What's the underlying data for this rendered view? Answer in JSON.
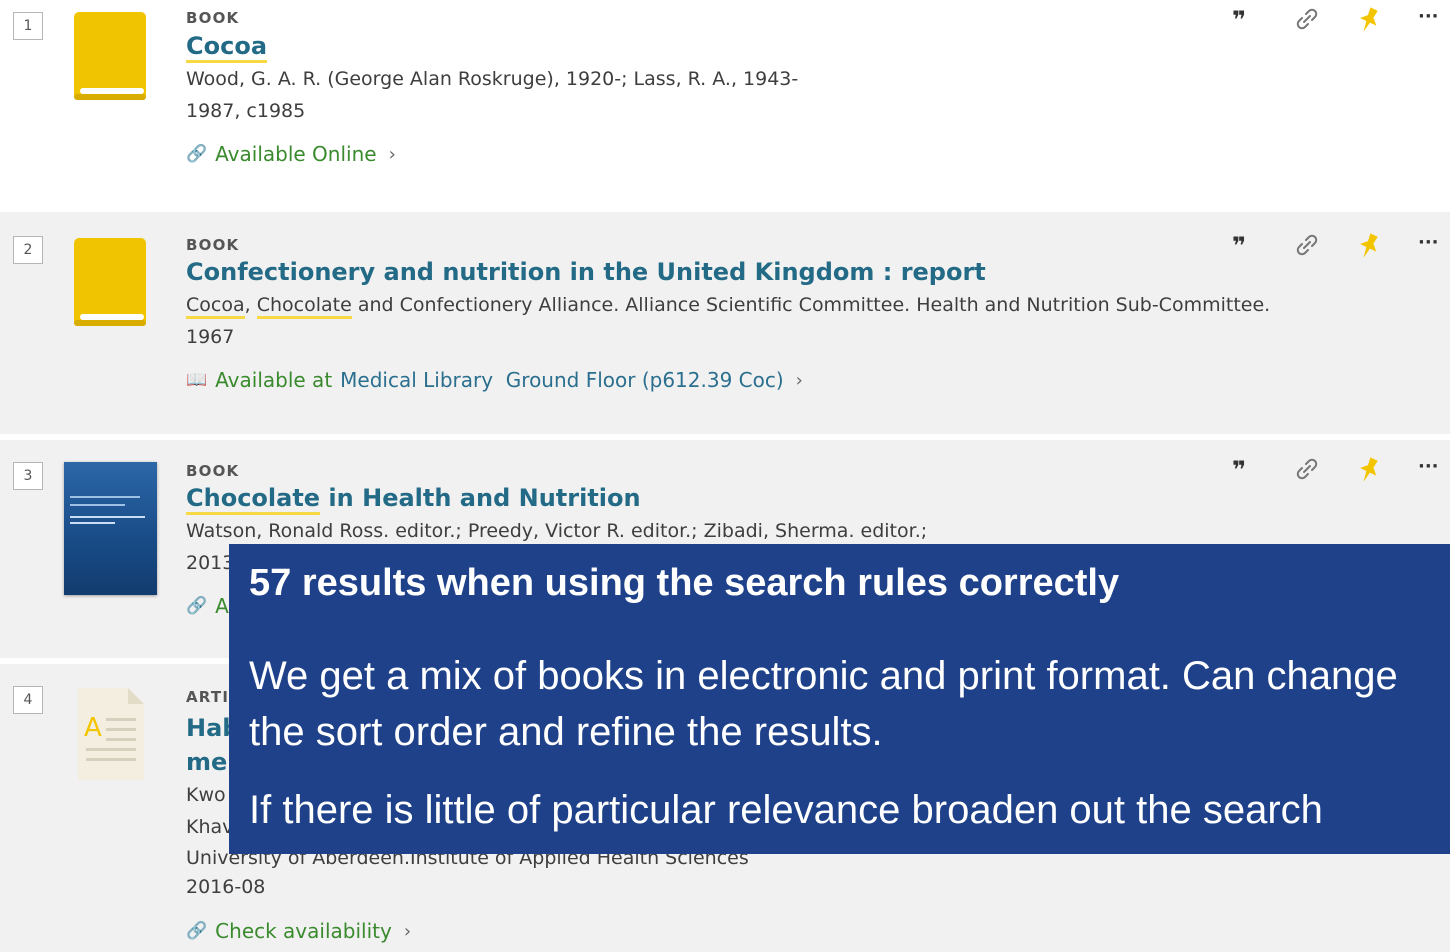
{
  "results": [
    {
      "number": "1",
      "type": "BOOK",
      "title_parts": [
        "Cocoa"
      ],
      "authors_parts": [
        "Wood, G. A. R. (George Alan Roskruge), 1920-; Lass, R. A., 1943-"
      ],
      "date": "1987, c1985",
      "availability": "Available Online",
      "icon": "book-icon",
      "color": "#f0c400"
    },
    {
      "number": "2",
      "type": "BOOK",
      "title": "Confectionery and nutrition in the United Kingdom : report",
      "authors_parts": [
        "Cocoa",
        ", ",
        "Chocolate",
        " and Confectionery Alliance. Alliance Scientific Committee. Health and Nutrition Sub-Committee."
      ],
      "date": "1967",
      "availability": "Available at",
      "location": "Medical Library  Ground Floor (p612.39 Coc)",
      "icon": "book-icon"
    },
    {
      "number": "3",
      "type": "BOOK",
      "title_parts": [
        "Chocolate",
        " in Health and Nutrition"
      ],
      "authors": "Watson, Ronald Ross. editor.; Preedy, Victor R. editor.; Zibadi, Sherma. editor.;",
      "date_partial": "2013",
      "availability_partial": "A",
      "icon": "book-cover"
    },
    {
      "number": "4",
      "type_partial": "ARTIC",
      "title_partial_1": "Hab",
      "title_partial_2": "mer",
      "authors_partial_1": "Kwo",
      "authors_partial_2": "Khav",
      "affiliation": "University of Aberdeen.Institute of Applied Health Sciences",
      "date": "2016-08",
      "availability": "Check availability",
      "icon": "article-icon"
    }
  ],
  "actions": {
    "cite_icon": "quote-icon",
    "link_icon": "link-icon",
    "pin_icon": "pin-icon",
    "more_icon": "more-icon",
    "glyph_quote": "❞",
    "glyph_link": "🔗",
    "glyph_more": "···"
  },
  "overlay": {
    "heading": "57 results when using the search rules correctly",
    "para1": "We get a mix of books in electronic and print format. Can change the sort order and refine the results.",
    "para2": "If there is little of particular relevance broaden out the search"
  },
  "colors": {
    "title": "#236a86",
    "available": "#3a8a2e",
    "highlight": "#f6d944",
    "overlay_bg": "#1e418a",
    "pin": "#f2c500",
    "book": "#f0c400"
  }
}
